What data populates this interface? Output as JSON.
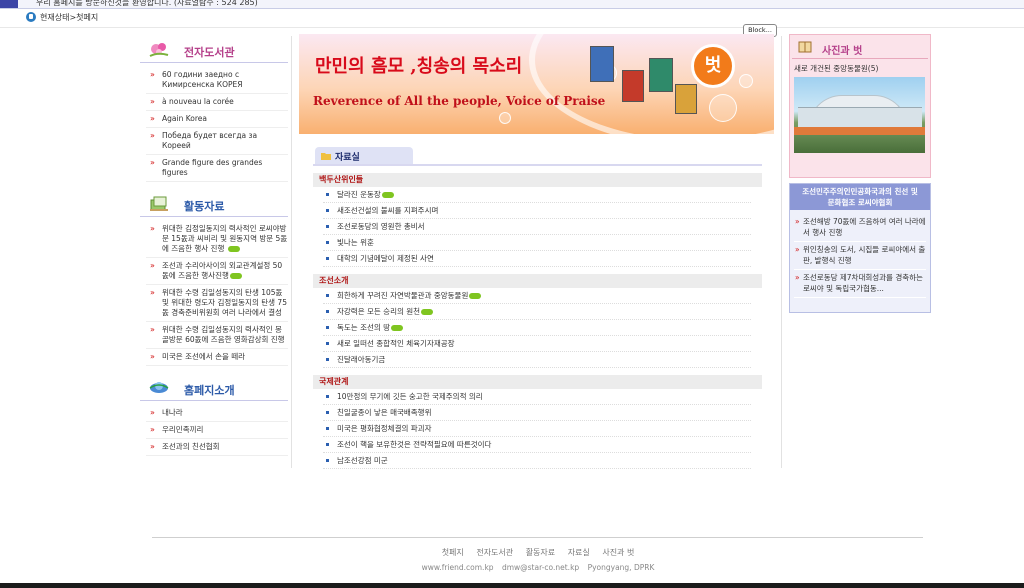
{
  "topbar": {
    "ticker": "우리 홈페지를 방문하신것을 환영합니다.  (자료열람수 : 524 285)"
  },
  "breadcrumb": {
    "text": "현재상태>첫페지"
  },
  "block_button": "Block...",
  "library": {
    "title": "전자도서관",
    "items": [
      "60 години заедно с Кимирсенска КОРЕЯ",
      "à nouveau la corée",
      "Again Korea",
      "Победа будет всегда за Кореей",
      "Grande figure des grandes figures"
    ]
  },
  "activities": {
    "title": "활동자료",
    "items": [
      "위대한 김정일동지의 력사적인 로씨야방문 15돐과 씨비리 및 원동지역 방문 5돐에 즈음한 행사 진행",
      "조선과 수리아사이의 외교관계설정 50돐에 즈음한 행사진행",
      "위대한 수령 김일성동지의 탄생 105돐 및 위대한 령도자 김정일동지의 탄생 75돐 경축준비위원회 여러 나라에서 결성",
      "위대한 수령 김일성동지의 력사적인 몽골방문 60돐에 즈음한 영화감상회 진행",
      "미국은 조선에서 손을 떼라"
    ]
  },
  "homepages": {
    "title": "홈페지소개",
    "items": [
      "내나라",
      "우리민족끼리",
      "조선과의 친선협회"
    ]
  },
  "banner": {
    "korean_title": "만민의 흠모 ,칭송의 목소리",
    "english_title": "Reverence of All the people, Voice of Praise",
    "seal": "벗"
  },
  "center": {
    "tab_label": "자료실",
    "groups": [
      {
        "title": "백두산위인들",
        "items": [
          "달라진 운동장",
          "새조선건설의 불씨를 지펴주시며",
          "조선로동당의 영원한 총비서",
          "빛나는 위훈",
          "대학의 기념메달이 제정된 사연"
        ],
        "new": [
          true,
          false,
          false,
          false,
          false
        ]
      },
      {
        "title": "조선소개",
        "items": [
          "희한하게 꾸려진 자연박물관과 중앙동물원",
          "자강력은 모든 승리의 원천",
          "독도는 조선의 땅",
          "새로 일떠선 종합적인 체육기자재공장",
          "진달래아동기금"
        ],
        "new": [
          true,
          true,
          true,
          false,
          false
        ]
      },
      {
        "title": "국제관계",
        "items": [
          "10만정의 무기에 깃든 숭고한 국제주의적 의리",
          "친일굴종이 낳은 매국배족행위",
          "미국은 평화협정체결의 파괴자",
          "조선이 핵을 보유한것은 전략적필요에 따른것이다",
          "남조선강점 미군"
        ],
        "new": [
          false,
          false,
          false,
          false,
          false
        ]
      }
    ]
  },
  "photo": {
    "title": "사진과 벗",
    "caption": "새로 개건된 중앙동물원(5)"
  },
  "association": {
    "title_line1": "조선민주주의인민공화국과의 친선 및",
    "title_line2": "문화협조 로씨야협회",
    "items": [
      "조선해방 70돐에 즈음하여 여러 나라에서 행사 진행",
      "위인칭송의 도서, 시집들 로씨야에서 출판, 발행식 진행",
      "조선로동당 제7차대회성과를 경축하는 로씨야 및 독립국가협동..."
    ]
  },
  "footer": {
    "nav": [
      "첫페지",
      "전자도서관",
      "활동자료",
      "자료실",
      "사진과 벗"
    ],
    "site": "www.friend.com.kp",
    "email": "dmw@star-co.net.kp",
    "location": "Pyongyang, DPRK"
  },
  "colors": {
    "accent_blue": "#3c45a6",
    "bullet_red": "#d01010",
    "pink_title": "#b5408a",
    "new_badge": "#7fc520"
  }
}
